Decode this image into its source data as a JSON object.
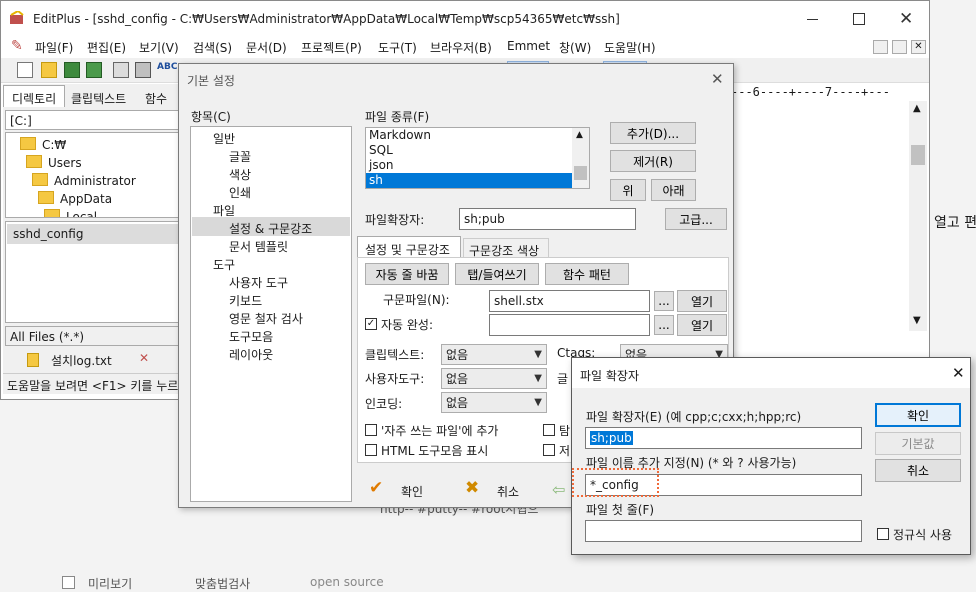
{
  "main_window": {
    "title": "EditPlus - [sshd_config - C:₩Users₩Administrator₩AppData₩Local₩Temp₩scp54365₩etc₩ssh]",
    "menu": [
      "파일(F)",
      "편집(E)",
      "보기(V)",
      "검색(S)",
      "문서(D)",
      "프로젝트(P)",
      "도구(T)",
      "브라우저(B)",
      "Emmet",
      "창(W)",
      "도움말(H)"
    ],
    "left_tabs": [
      "디렉토리",
      "클립텍스트",
      "함수"
    ],
    "drive": "[C:]",
    "tree": [
      "C:₩",
      "Users",
      "Administrator",
      "AppData",
      "Local"
    ],
    "file_list": [
      "sshd_config"
    ],
    "filter": "All Files (*.*)",
    "doc_tabs": [
      "설치log.txt"
    ],
    "status": "도움말을 보려면 <F1> 키를 누르",
    "ruler": "---6----+----7----+---",
    "right_text": "열고 편",
    "bottom_peek": "http-- #putty-- #root시협으",
    "bottom_bar": [
      "미리보기",
      "맞춤법검사",
      "open source"
    ]
  },
  "settings_dialog": {
    "title": "기본 설정",
    "category_label": "항목(C)",
    "categories": [
      {
        "label": "일반",
        "level": 0
      },
      {
        "label": "글꼴",
        "level": 1
      },
      {
        "label": "색상",
        "level": 1
      },
      {
        "label": "인쇄",
        "level": 1
      },
      {
        "label": "파일",
        "level": 0
      },
      {
        "label": "설정 & 구문강조",
        "level": 1,
        "selected": true
      },
      {
        "label": "문서 템플릿",
        "level": 1
      },
      {
        "label": "도구",
        "level": 0
      },
      {
        "label": "사용자 도구",
        "level": 1
      },
      {
        "label": "키보드",
        "level": 1
      },
      {
        "label": "영문 철자 검사",
        "level": 1
      },
      {
        "label": "도구모음",
        "level": 1
      },
      {
        "label": "레이아웃",
        "level": 1
      }
    ],
    "filetype_label": "파일 종류(F)",
    "filetypes": [
      {
        "label": "Markdown"
      },
      {
        "label": "SQL"
      },
      {
        "label": "json"
      },
      {
        "label": "sh",
        "selected": true
      }
    ],
    "add_button": "추가(D)...",
    "remove_button": "제거(R)",
    "up_button": "위",
    "down_button": "아래",
    "ext_label": "파일확장자:",
    "ext_value": "sh;pub",
    "advanced_button": "고급...",
    "tabs": [
      "설정 및 구문강조",
      "구문강조 색상"
    ],
    "wordwrap_button": "자동 줄 바꿈",
    "tab_indent_button": "탭/들여쓰기",
    "function_pattern_button": "함수 패턴",
    "syntax_file_label": "구문파일(N):",
    "syntax_file_value": "shell.stx",
    "browse_label": "...",
    "open_label": "열기",
    "autocomplete_label": "자동 완성:",
    "autocomplete_checked": true,
    "autocomplete_value": "",
    "cliptext_label": "클립텍스트:",
    "cliptext_value": "없음",
    "usertool_label": "사용자도구:",
    "usertool_value": "없음",
    "encoding_label": "인코딩:",
    "encoding_value": "없음",
    "ctags_label": "Ctags:",
    "ctags_value": "없음",
    "partial_label": "글",
    "recent_files_label": "'자주 쓰는 파일'에 추가",
    "html_toolbar_label": "HTML 도구모음 표시",
    "partial_tab": "탐",
    "partial_save": "저",
    "ok_label": "확인",
    "cancel_label": "취소"
  },
  "ext_dialog": {
    "title": "파일 확장자",
    "ext_label": "파일 확장자(E) (예 cpp;c;cxx;h;hpp;rc)",
    "ext_value": "sh;pub",
    "name_label": "파일 이름 추가 지정(N) (* 와 ? 사용가능)",
    "name_value": "*_config",
    "first_line_label": "파일 첫 줄(F)",
    "first_line_value": "",
    "ok_button": "확인",
    "default_button": "기본값",
    "cancel_button": "취소",
    "regex_label": "정규식 사용"
  }
}
